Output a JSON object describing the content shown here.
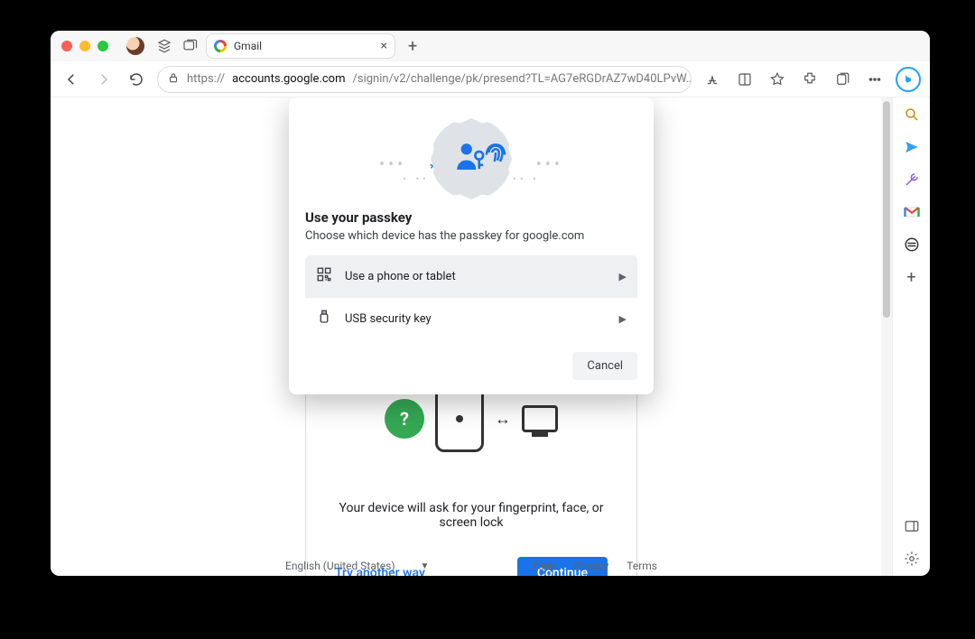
{
  "browser": {
    "tab_title": "Gmail",
    "url_domain": "accounts.google.com",
    "url_prefix": "https://",
    "url_path": "/signin/v2/challenge/pk/presend?TL=AG7eRGDrAZ7wD40LPvW…"
  },
  "page": {
    "message": "Your device will ask for your fingerprint, face, or screen lock",
    "try_another": "Try another way",
    "continue": "Continue"
  },
  "footer": {
    "language": "English (United States)",
    "help": "Help",
    "privacy": "Privacy",
    "terms": "Terms"
  },
  "modal": {
    "title": "Use your passkey",
    "subtitle": "Choose which device has the passkey for google.com",
    "options": [
      {
        "label": "Use a phone or tablet",
        "selected": true
      },
      {
        "label": "USB security key",
        "selected": false
      }
    ],
    "cancel": "Cancel"
  }
}
